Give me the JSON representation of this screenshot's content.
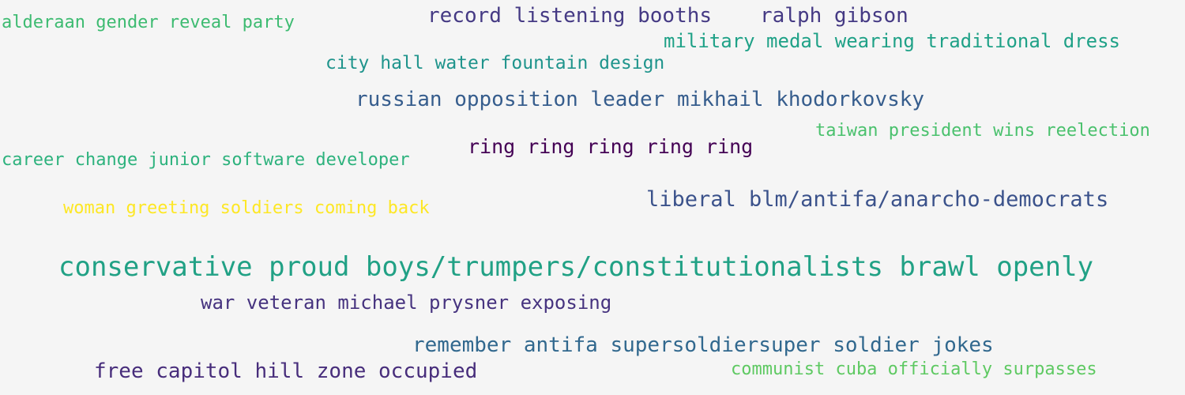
{
  "phrases": [
    {
      "text": "alderaan gender reveal party",
      "color": "#3dbb71"
    },
    {
      "text": "record listening booths",
      "color": "#453a84"
    },
    {
      "text": "ralph gibson",
      "color": "#453a84"
    },
    {
      "text": "military medal wearing traditional dress",
      "color": "#1fa187"
    },
    {
      "text": "city hall water fountain design",
      "color": "#1f948c"
    },
    {
      "text": "russian opposition leader mikhail khodorkovsky",
      "color": "#365d8d"
    },
    {
      "text": "taiwan president wins reelection",
      "color": "#4ac16d"
    },
    {
      "text": "career change junior software developer",
      "color": "#2db27d"
    },
    {
      "text": "ring ring ring ring ring",
      "color": "#440154"
    },
    {
      "text": "liberal blm/antifa/anarcho-democrats",
      "color": "#3b528b"
    },
    {
      "text": "woman greeting soldiers coming back",
      "color": "#fde725"
    },
    {
      "text": "conservative proud boys/trumpers/constitutionalists brawl openly",
      "color": "#21a185"
    },
    {
      "text": "war veteran michael prysner exposing",
      "color": "#46337f"
    },
    {
      "text": "remember antifa supersoldiersuper soldier jokes",
      "color": "#31688e"
    },
    {
      "text": "free capitol hill zone occupied",
      "color": "#472d7b"
    },
    {
      "text": "communist cuba officially surpasses",
      "color": "#5ec962"
    }
  ]
}
